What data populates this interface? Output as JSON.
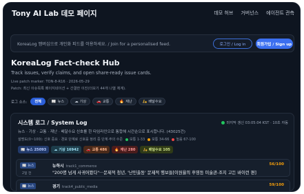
{
  "header": {
    "brand": "Tony AI Lab 데모 페이지",
    "nav": [
      "데모 허브",
      "거버넌스",
      "에이전트 관측"
    ]
  },
  "banner": {
    "text": "KoreaLog 멤버십으로 개인화 피드를 이용하세요. / Join for a personalised feed.",
    "login_label": "로그인 / Log in",
    "signup_label": "회원가입 / Sign up"
  },
  "hub": {
    "title": "KoreaLog Fact-check Hub",
    "subtitle": "Track issues, verify claims, and open share-ready issue cards.",
    "patch_marker": "Live patch marker: TON-8-R16 · 2026-05-29",
    "patch_note": "Patch: 최신 이슈목록 페이지네이션 + 간결한 이진(더보기 44개 나열 체계)."
  },
  "filters": {
    "label": "로그 소스:",
    "chips": [
      {
        "label": "전체",
        "icon": "",
        "active": true
      },
      {
        "label": "뉴스",
        "icon": "📰",
        "active": false
      },
      {
        "label": "기상",
        "icon": "☁",
        "active": false
      },
      {
        "label": "교통",
        "icon": "🚗",
        "active": false
      },
      {
        "label": "재난",
        "icon": "🔥",
        "active": false
      },
      {
        "label": "배달수요",
        "icon": "🛵",
        "active": false
      }
    ]
  },
  "system_log": {
    "title": "시스템 로그 / System Log",
    "status": "마지막 갱신 03:05:04 KST · 10초 자동",
    "status_color": "#22c55e",
    "description": "뉴스 · 기상 · 교통 · 재난 · 배달수요 신호를 한 타임라인으로 통합해 시간순으로 표시합니다. (43025건)",
    "legend_prefix": "설명도(0~100): 신호 중요 · 경보 단계로 신호를 정리 중 단계·주의 수준",
    "legend": [
      {
        "label": "보통 1-33",
        "color": "#22c55e"
      },
      {
        "label": "보통 34-66",
        "color": "#f59e0b"
      },
      {
        "label": "높음 67-100",
        "color": "#ef4444"
      }
    ],
    "counts": [
      {
        "icon": "📰",
        "label": "뉴스 25093",
        "bg": "#223a6b",
        "fg": "#b9ccff"
      },
      {
        "icon": "☁",
        "label": "기상 16942",
        "bg": "#1d3c4a",
        "fg": "#9fe0f5"
      },
      {
        "icon": "🚗",
        "label": "교통 486",
        "bg": "#4a2a1a",
        "fg": "#ffb48a"
      },
      {
        "icon": "🔥",
        "label": "재난 280",
        "bg": "#4a1c1c",
        "fg": "#ff9a9a"
      },
      {
        "icon": "🛵",
        "label": "배달수요 105",
        "bg": "#2f3a17",
        "fg": "#cfe58a"
      }
    ]
  },
  "feed": [
    {
      "source": "뉴스",
      "when": "2일 전",
      "outlet": "뉴하시",
      "track": "track1_commerce",
      "headline": "\"200명 넘게 사귀어봤다\"···문제적 청년, '난민출동' 문제적 행보들[이원율의 후영등 미술관-조지 고든 바이런 편]",
      "score": "56/100"
    },
    {
      "source": "뉴스",
      "when": "",
      "outlet": "경기",
      "track": "track4_public_media",
      "headline": "",
      "score": "59/100"
    }
  ]
}
